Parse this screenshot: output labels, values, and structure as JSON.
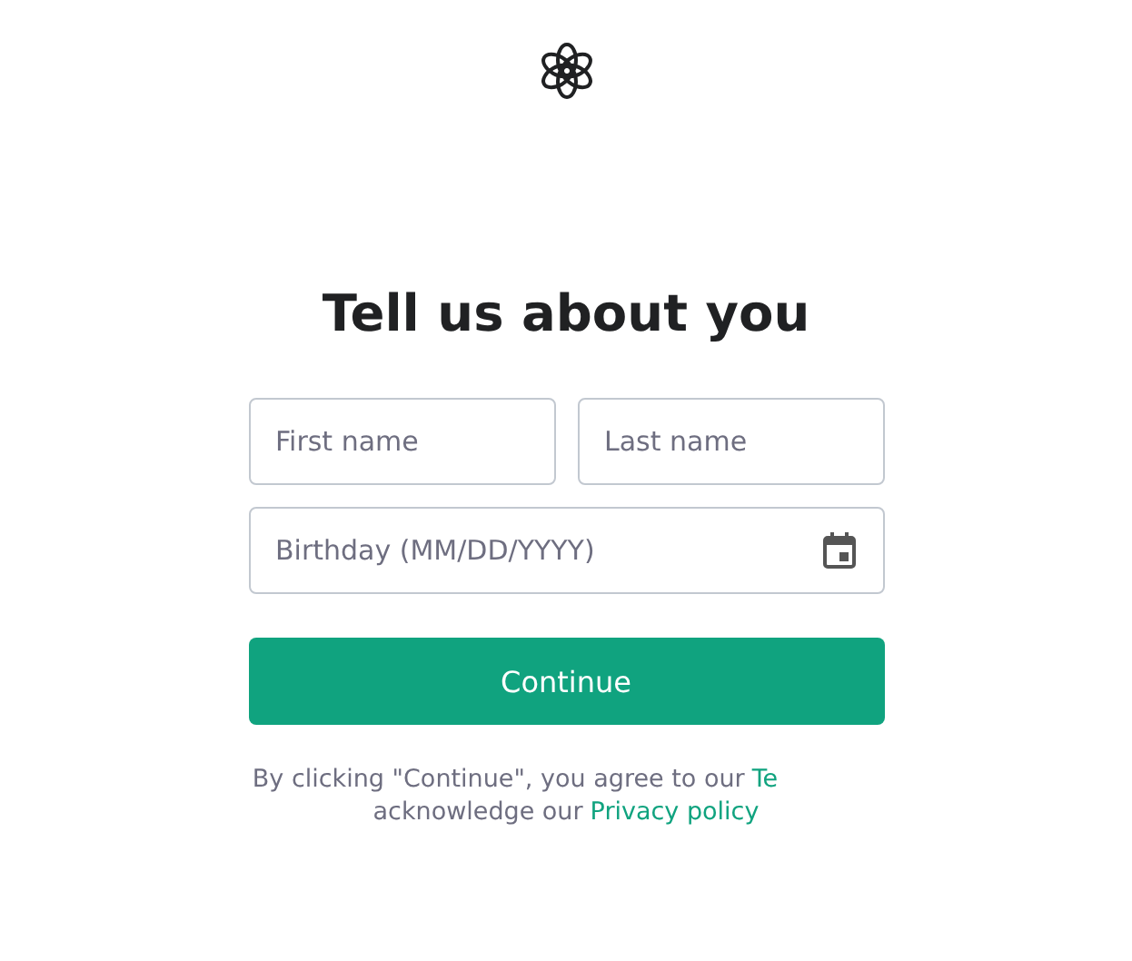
{
  "heading": "Tell us about you",
  "fields": [
    {
      "placeholder": "First name"
    },
    {
      "placeholder": "Last name"
    }
  ],
  "birthday": {
    "placeholder": "Birthday (MM/DD/YYYY)"
  },
  "button": "Continue",
  "legal": {
    "line_1": "By clicking \"Continue\", you agree to our",
    "terms_link": "Te",
    "line_2": "acknowledge our",
    "privacy_link": "Privacy policy"
  }
}
